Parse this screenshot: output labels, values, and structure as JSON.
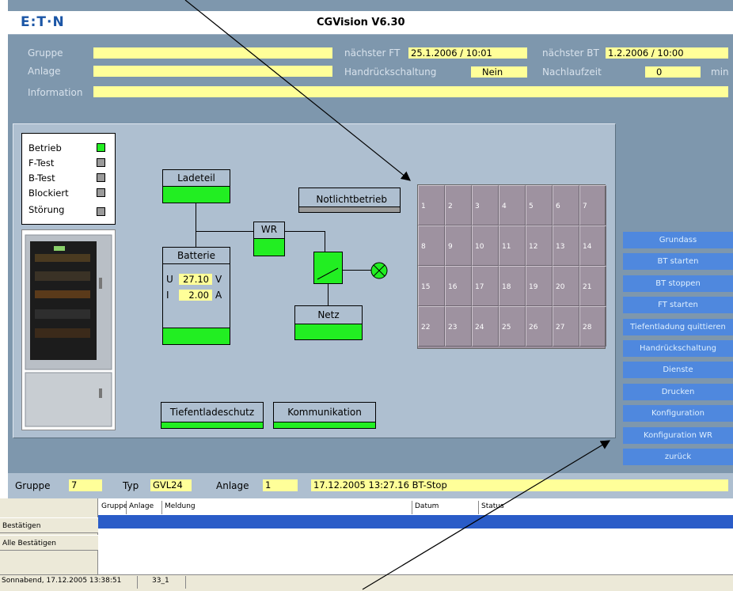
{
  "app": {
    "logo": "E:T·N",
    "title": "CGVision V6.30"
  },
  "header": {
    "gruppe_label": "Gruppe",
    "anlage_label": "Anlage",
    "information_label": "Information",
    "next_ft_label": "nächster FT",
    "next_ft_value": "25.1.2006 / 10:01",
    "next_bt_label": "nächster BT",
    "next_bt_value": "1.2.2006 / 10:00",
    "handrueck_label": "Handrückschaltung",
    "handrueck_value": "Nein",
    "nachlauf_label": "Nachlaufzeit",
    "nachlauf_value": "0",
    "nachlauf_unit": "min"
  },
  "status": [
    {
      "label": "Betrieb",
      "on": true
    },
    {
      "label": "F-Test",
      "on": false
    },
    {
      "label": "B-Test",
      "on": false
    },
    {
      "label": "Blockiert",
      "on": false
    },
    {
      "label": "Störung",
      "on": false
    }
  ],
  "diagram": {
    "ladeteil": "Ladeteil",
    "notlicht": "Notlichtbetrieb",
    "wr": "WR",
    "batterie": "Batterie",
    "u_label": "U",
    "u_value": "27.10",
    "u_unit": "V",
    "i_label": "I",
    "i_value": "2.00",
    "i_unit": "A",
    "netz": "Netz",
    "tiefentladeschutz": "Tiefentladeschutz",
    "kommunikation": "Kommunikation"
  },
  "grid_cells": [
    "1",
    "2",
    "3",
    "4",
    "5",
    "6",
    "7",
    "8",
    "9",
    "10",
    "11",
    "12",
    "13",
    "14",
    "15",
    "16",
    "17",
    "18",
    "19",
    "20",
    "21",
    "22",
    "23",
    "24",
    "25",
    "26",
    "27",
    "28"
  ],
  "menu": [
    "Grundass",
    "BT starten",
    "BT stoppen",
    "FT starten",
    "Tiefentladung quittieren",
    "Handrückschaltung",
    "Dienste",
    "Drucken",
    "Konfiguration",
    "Konfiguration WR",
    "zurück"
  ],
  "bottom": {
    "gruppe_label": "Gruppe",
    "gruppe_value": "7",
    "typ_label": "Typ",
    "typ_value": "GVL24",
    "anlage_label": "Anlage",
    "anlage_value": "1",
    "message": "17.12.2005 13:27.16  BT-Stop"
  },
  "messages": {
    "confirm": "Bestätigen",
    "confirm_all": "Alle Bestätigen",
    "columns": [
      "Gruppe",
      "Anlage",
      "Meldung",
      "Datum",
      "Status"
    ]
  },
  "statusbar": {
    "datetime": "Sonnabend, 17.12.2005 13:38:51",
    "code": "33_1"
  },
  "colors": {
    "frame": "#7e97ad",
    "panel": "#aebfd0",
    "field": "#ffff99",
    "led_on": "#22ee22",
    "button": "#4f88de",
    "grid": "#9e92a0"
  }
}
